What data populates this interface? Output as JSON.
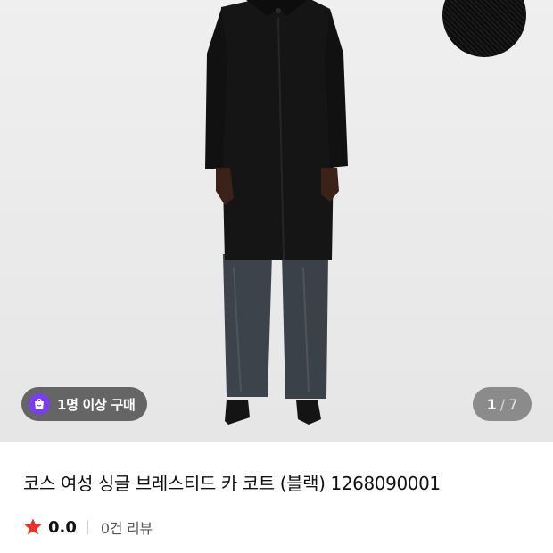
{
  "gallery": {
    "badge_text": "1명 이상 구매",
    "current_page": "1",
    "page_separator": "/",
    "total_pages": "7",
    "badge_color": "#7b3cf5"
  },
  "product": {
    "title": "코스 여성 싱글 브레스티드 카 코트 (블랙) 1268090001",
    "rating": "0.0",
    "reviews_label": "0건 리뷰",
    "star_color": "#e8332a"
  }
}
